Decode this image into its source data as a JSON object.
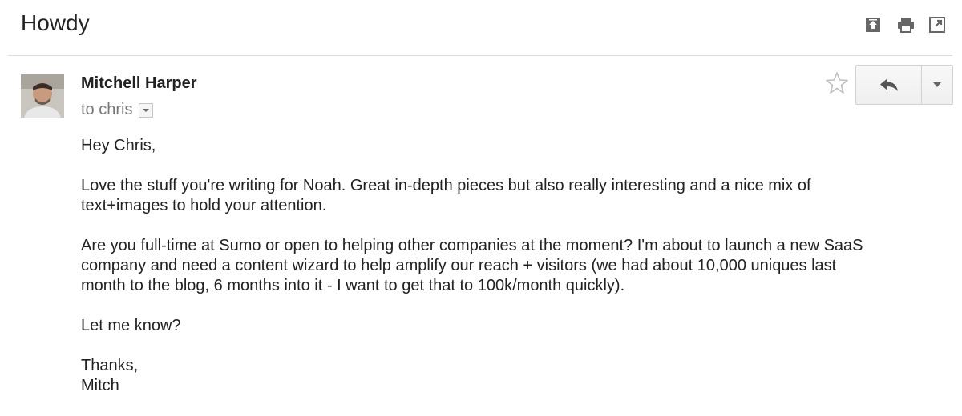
{
  "email": {
    "subject": "Howdy",
    "sender_name": "Mitchell Harper",
    "recipient_line": "to chris",
    "body_paragraphs": [
      "Hey Chris,",
      "Love the stuff you're writing for Noah. Great in-depth pieces but also really interesting and a nice mix of\ntext+images to hold your attention.",
      "Are you full-time at Sumo or open to helping other companies at the moment? I'm about to launch a new SaaS\ncompany and need a content wizard to help amplify our reach + visitors (we had about 10,000 uniques last\nmonth to the blog, 6 months into it - I want to get that to 100k/month quickly).",
      "Let me know?",
      "Thanks,\nMitch"
    ]
  },
  "toolbar": {
    "icons": [
      "archive-up-icon",
      "print-icon",
      "open-in-new-window-icon"
    ]
  },
  "message_actions": {
    "icons": [
      "star-icon",
      "reply-icon",
      "chevron-down-icon"
    ]
  }
}
